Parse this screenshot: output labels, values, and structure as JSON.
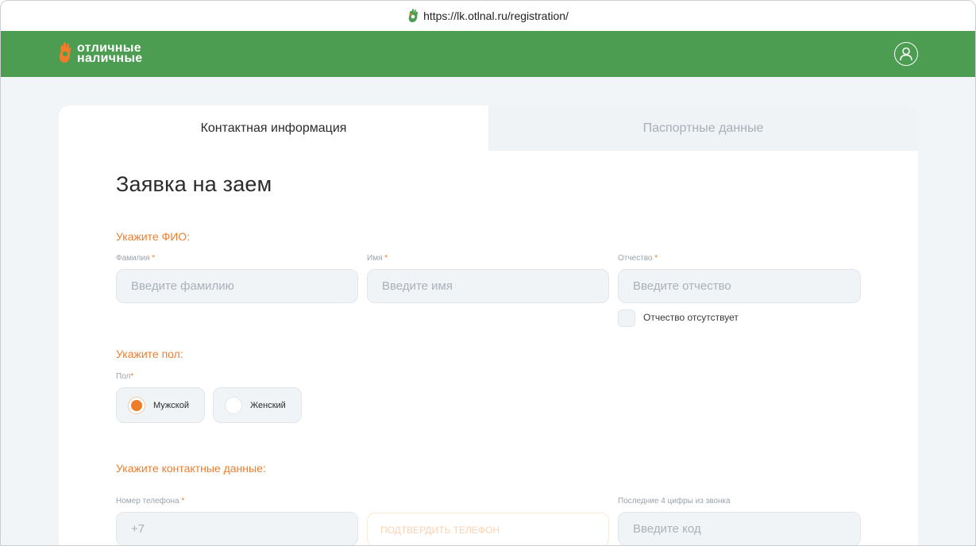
{
  "browser": {
    "url": "https://lk.otlnal.ru/registration/"
  },
  "header": {
    "logo_line1": "отличные",
    "logo_line2": "наличные",
    "accent": "#4c9c51",
    "profile_icon": "user-circle-icon"
  },
  "tabs": [
    {
      "label": "Контактная информация",
      "active": true
    },
    {
      "label": "Паспортные данные",
      "active": false
    }
  ],
  "form": {
    "title": "Заявка на заем",
    "fio_section": "Укажите ФИО:",
    "surname": {
      "label": "Фамилия",
      "required": "*",
      "placeholder": "Введите фамилию"
    },
    "name": {
      "label": "Имя",
      "required": "*",
      "placeholder": "Введите имя"
    },
    "patronymic": {
      "label": "Отчество",
      "required": "*",
      "placeholder": "Введите отчество"
    },
    "no_patronymic": {
      "label": "Отчество отсутствует",
      "checked": false
    },
    "gender_section": "Укажите пол:",
    "gender": {
      "label": "Пол",
      "required": "*",
      "options": [
        {
          "label": "Мужской",
          "checked": true
        },
        {
          "label": "Женский",
          "checked": false
        }
      ]
    },
    "contacts_section": "Укажите контактные данные:",
    "phone": {
      "label": "Номер телефона",
      "required": "*",
      "placeholder": "+7"
    },
    "confirm_button": "ПОДТВЕРДИТЬ ТЕЛЕФОН",
    "code": {
      "label": "Последние 4 цифры из звонка",
      "placeholder": "Введите код"
    }
  },
  "colors": {
    "orange": "#ee7d2b",
    "green": "#4c9c51"
  }
}
